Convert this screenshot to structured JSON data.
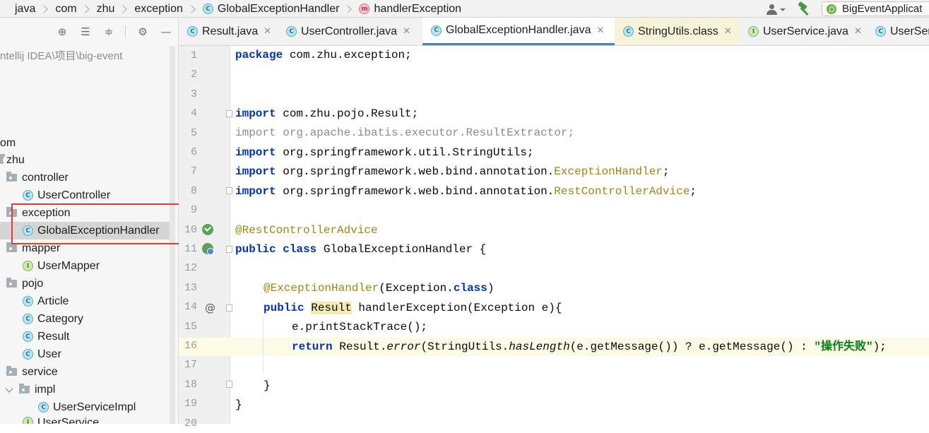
{
  "breadcrumb": {
    "items": [
      {
        "label": "java",
        "badge": ""
      },
      {
        "label": "com",
        "badge": ""
      },
      {
        "label": "zhu",
        "badge": ""
      },
      {
        "label": "exception",
        "badge": ""
      },
      {
        "label": "GlobalExceptionHandler",
        "badge": "c"
      },
      {
        "label": "handlerException",
        "badge": "m"
      }
    ]
  },
  "toolbar": {
    "run_config": "BigEventApplicat"
  },
  "project_panel": {
    "path_hint": "ntellij IDEA\\项目\\big-event",
    "tree": [
      {
        "label": "om",
        "kind": "text"
      },
      {
        "label": "zhu",
        "kind": "folder"
      },
      {
        "label": "controller",
        "kind": "folder"
      },
      {
        "label": "UserController",
        "kind": "class"
      },
      {
        "label": "exception",
        "kind": "folder"
      },
      {
        "label": "GlobalExceptionHandler",
        "kind": "class",
        "selected": true
      },
      {
        "label": "mapper",
        "kind": "folder"
      },
      {
        "label": "UserMapper",
        "kind": "interface"
      },
      {
        "label": "pojo",
        "kind": "folder"
      },
      {
        "label": "Article",
        "kind": "class"
      },
      {
        "label": "Category",
        "kind": "class"
      },
      {
        "label": "Result",
        "kind": "class"
      },
      {
        "label": "User",
        "kind": "class"
      },
      {
        "label": "service",
        "kind": "folder"
      },
      {
        "label": "impl",
        "kind": "folder",
        "expanded": true
      },
      {
        "label": "UserServiceImpl",
        "kind": "class"
      },
      {
        "label": "UserService",
        "kind": "interface"
      }
    ]
  },
  "tabs": [
    {
      "label": "Result.java",
      "icon": "c"
    },
    {
      "label": "UserController.java",
      "icon": "c"
    },
    {
      "label": "GlobalExceptionHandler.java",
      "icon": "c",
      "active": true
    },
    {
      "label": "StringUtils.class",
      "icon": "c"
    },
    {
      "label": "UserService.java",
      "icon": "i"
    },
    {
      "label": "UserSer",
      "icon": "c"
    }
  ],
  "editor": {
    "line_numbers": [
      "1",
      "2",
      "3",
      "4",
      "5",
      "6",
      "7",
      "8",
      "9",
      "10",
      "11",
      "12",
      "13",
      "14",
      "15",
      "16",
      "17",
      "18",
      "19",
      "20"
    ],
    "lines": {
      "l1": {
        "kw": "package",
        "rest": " com.zhu.exception;"
      },
      "l4": {
        "kw": "import",
        "rest": " com.zhu.pojo.Result;"
      },
      "l5": {
        "kw": "import",
        "rest": " org.apache.ibatis.executor.ResultExtractor;"
      },
      "l6": {
        "kw": "import",
        "rest": " org.springframework.util.StringUtils;"
      },
      "l7": {
        "kw": "import",
        "rest": " org.springframework.web.bind.annotation.",
        "ann": "ExceptionHandler",
        "end": ";"
      },
      "l8": {
        "kw": "import",
        "rest": " org.springframework.web.bind.annotation.",
        "ann": "RestControllerAdvice",
        "end": ";"
      },
      "l10": {
        "ann": "@RestControllerAdvice"
      },
      "l11": {
        "kw1": "public",
        "kw2": "class",
        "rest": " GlobalExceptionHandler {"
      },
      "l13": {
        "ann": "@ExceptionHandler",
        "mid": "(Exception.",
        "kw": "class",
        "end": ")"
      },
      "l14": {
        "kw": "public",
        "type": "Result",
        "rest": " handlerException(Exception e){"
      },
      "l15": {
        "text": "e.printStackTrace();"
      },
      "l16": {
        "kw": "return",
        "a": " Result.",
        "b": "error",
        "c": "(StringUtils.",
        "d": "hasLength",
        "e": "(e.getMessage()) ? e.getMessage() : ",
        "str": "\"操作失败\"",
        "end": ");"
      },
      "l18": {
        "text": "}"
      },
      "l19": {
        "text": "}"
      }
    }
  },
  "colors": {
    "keyword": "#0033b3",
    "annotation": "#9e880d",
    "string": "#067d17",
    "highlight_box": "#e53935",
    "active_tab_underline": "#4083c9"
  }
}
